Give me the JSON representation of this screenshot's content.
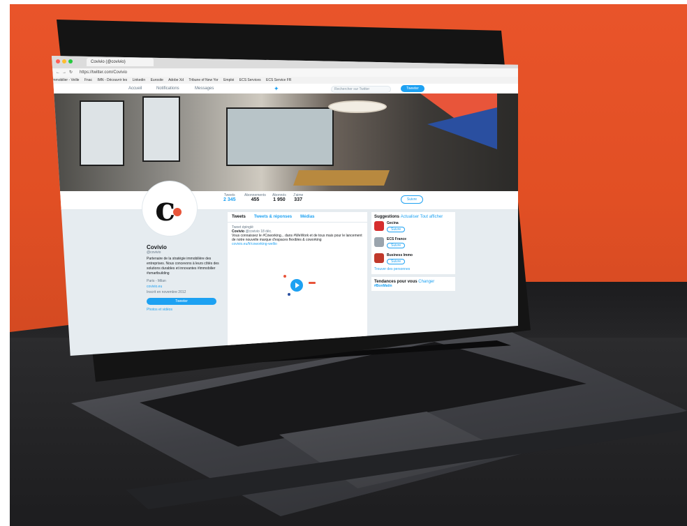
{
  "browser": {
    "tab_title": "Covivio (@covivio)",
    "url": "https://twitter.com/Covivio",
    "bookmarks": [
      "Immobilier - Veille",
      "Fnac",
      "IMN - Découvrir les",
      "Linkedin",
      "Eurosite",
      "Adobe Xd",
      "Tribune of New Yor",
      "Emploi",
      "ECS Services",
      "ECS Service FR"
    ]
  },
  "twitter_nav": {
    "home": "Accueil",
    "notifications": "Notifications",
    "messages": "Messages",
    "search_placeholder": "Rechercher sur Twitter",
    "tweet_button": "Tweeter"
  },
  "profile": {
    "name": "Covivio",
    "handle": "@covivio",
    "bio": "Partenaire de la stratégie immobilière des entreprises. Nous concevons à leurs côtés des solutions durables et innovantes #immobilier #smartbuilding",
    "location": "Paris - Milan",
    "website": "covivio.eu",
    "joined": "Inscrit en novembre 2012",
    "tweet_button": "Tweeter",
    "photos_link": "Photos et vidéos",
    "follow_button": "Suivre",
    "stats": [
      {
        "label": "Tweets",
        "value": "2 345"
      },
      {
        "label": "Abonnements",
        "value": "455"
      },
      {
        "label": "Abonnés",
        "value": "1 950"
      },
      {
        "label": "J'aime",
        "value": "337"
      }
    ]
  },
  "timeline": {
    "tabs": [
      "Tweets",
      "Tweets & réponses",
      "Médias"
    ],
    "pinned": "Tweet épinglé",
    "tweet_author": "Covivio",
    "tweet_handle": "@covivio",
    "tweet_date": "18 déc.",
    "tweet_text": "Vous connaissez le #Coworking... dans #WeWork et de tous mais pour le lancement de notre nouvelle marque d'espaces flexibles & coworking",
    "tweet_link": "covivio.eu/fr/coworking-wellio"
  },
  "suggestions": {
    "title": "Suggestions",
    "refresh": "Actualiser",
    "view_all": "Tout afficher",
    "items": [
      {
        "name": "Gecina",
        "follow": "Suivre",
        "color": "#d62e2e"
      },
      {
        "name": "ECS France",
        "follow": "Suivre",
        "color": "#9aa4ad"
      },
      {
        "name": "Business Immo",
        "follow": "Suivre",
        "color": "#c0392b"
      }
    ],
    "find_people": "Trouver des personnes"
  },
  "trends": {
    "title": "Tendances pour vous",
    "change": "Changer",
    "first": "#BonMatin"
  },
  "colors": {
    "wall": "#e14f24",
    "twitter_blue": "#1da1f2",
    "brand_red": "#e8553a",
    "brand_blue": "#2a4fa0"
  }
}
